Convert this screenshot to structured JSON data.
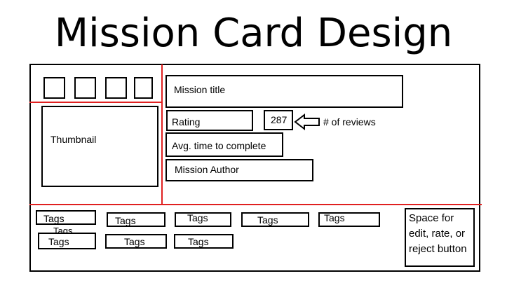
{
  "title": "Mission Card Design",
  "thumbnail_label": "Thumbnail",
  "mission_title_label": "Mission title",
  "rating_label": "Rating",
  "review_count": "287",
  "reviews_annotation": "# of reviews",
  "avg_time_label": "Avg. time to complete",
  "author_label": "Mission Author",
  "tags": [
    "Tags",
    "Tags",
    "Tags",
    "Tags",
    "Tags",
    "Tags",
    "Tags",
    "Tags",
    "Tags"
  ],
  "overlapping_tag_text": "Tags",
  "action_space_label": "Space for edit, rate, or reject button",
  "colors": {
    "divider": "#e02020",
    "ink": "#000000"
  },
  "icons": [
    "left-arrow-icon"
  ]
}
